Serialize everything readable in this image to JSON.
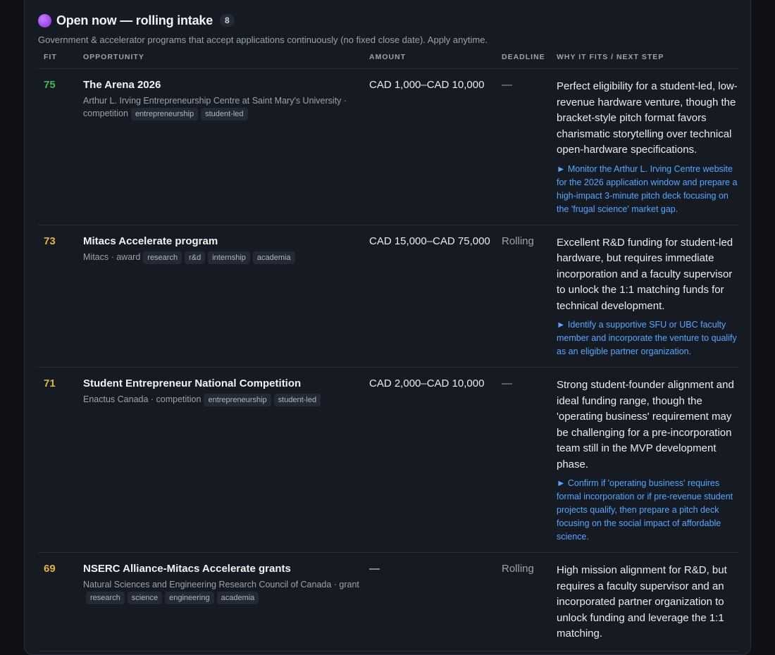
{
  "section": {
    "title": "Open now — rolling intake",
    "count": "8",
    "subtitle": "Government & accelerator programs that accept applications continuously (no fixed close date). Apply anytime."
  },
  "columns": {
    "fit": "FIT",
    "opportunity": "OPPORTUNITY",
    "amount": "AMOUNT",
    "deadline": "DEADLINE",
    "why": "WHY IT FITS / NEXT STEP"
  },
  "rows": [
    {
      "fit": "75",
      "name": "The Arena 2026",
      "org": "Arthur L. Irving Entrepreneurship Centre at Saint Mary's University · competition",
      "tags": [
        "entrepreneurship",
        "student-led"
      ],
      "amount": "CAD 1,000–CAD 10,000",
      "deadline": "—",
      "why": "Perfect eligibility for a student-led, low-revenue hardware venture, though the bracket-style pitch format favors charismatic storytelling over technical open-hardware specifications.",
      "step": "► Monitor the Arthur L. Irving Centre website for the 2026 application window and prepare a high-impact 3-minute pitch deck focusing on the 'frugal science' market gap."
    },
    {
      "fit": "73",
      "name": "Mitacs Accelerate program",
      "org": "Mitacs · award",
      "tags": [
        "research",
        "r&d",
        "internship",
        "academia"
      ],
      "amount": "CAD 15,000–CAD 75,000",
      "deadline": "Rolling",
      "why": "Excellent R&D funding for student-led hardware, but requires immediate incorporation and a faculty supervisor to unlock the 1:1 matching funds for technical development.",
      "step": "► Identify a supportive SFU or UBC faculty member and incorporate the venture to qualify as an eligible partner organization."
    },
    {
      "fit": "71",
      "name": "Student Entrepreneur National Competition",
      "org": "Enactus Canada · competition",
      "tags": [
        "entrepreneurship",
        "student-led"
      ],
      "amount": "CAD 2,000–CAD 10,000",
      "deadline": "—",
      "why": "Strong student-founder alignment and ideal funding range, though the 'operating business' requirement may be challenging for a pre-incorporation team still in the MVP development phase.",
      "step": "► Confirm if 'operating business' requires formal incorporation or if pre-revenue student projects qualify, then prepare a pitch deck focusing on the social impact of affordable science."
    },
    {
      "fit": "69",
      "name": "NSERC Alliance-Mitacs Accelerate grants",
      "org": "Natural Sciences and Engineering Research Council of Canada · grant",
      "tags": [
        "research",
        "science",
        "engineering",
        "academia"
      ],
      "amount": "—",
      "deadline": "Rolling",
      "why": "High mission alignment for R&D, but requires a faculty supervisor and an incorporated partner organization to unlock funding and leverage the 1:1 matching.",
      "step": ""
    }
  ]
}
